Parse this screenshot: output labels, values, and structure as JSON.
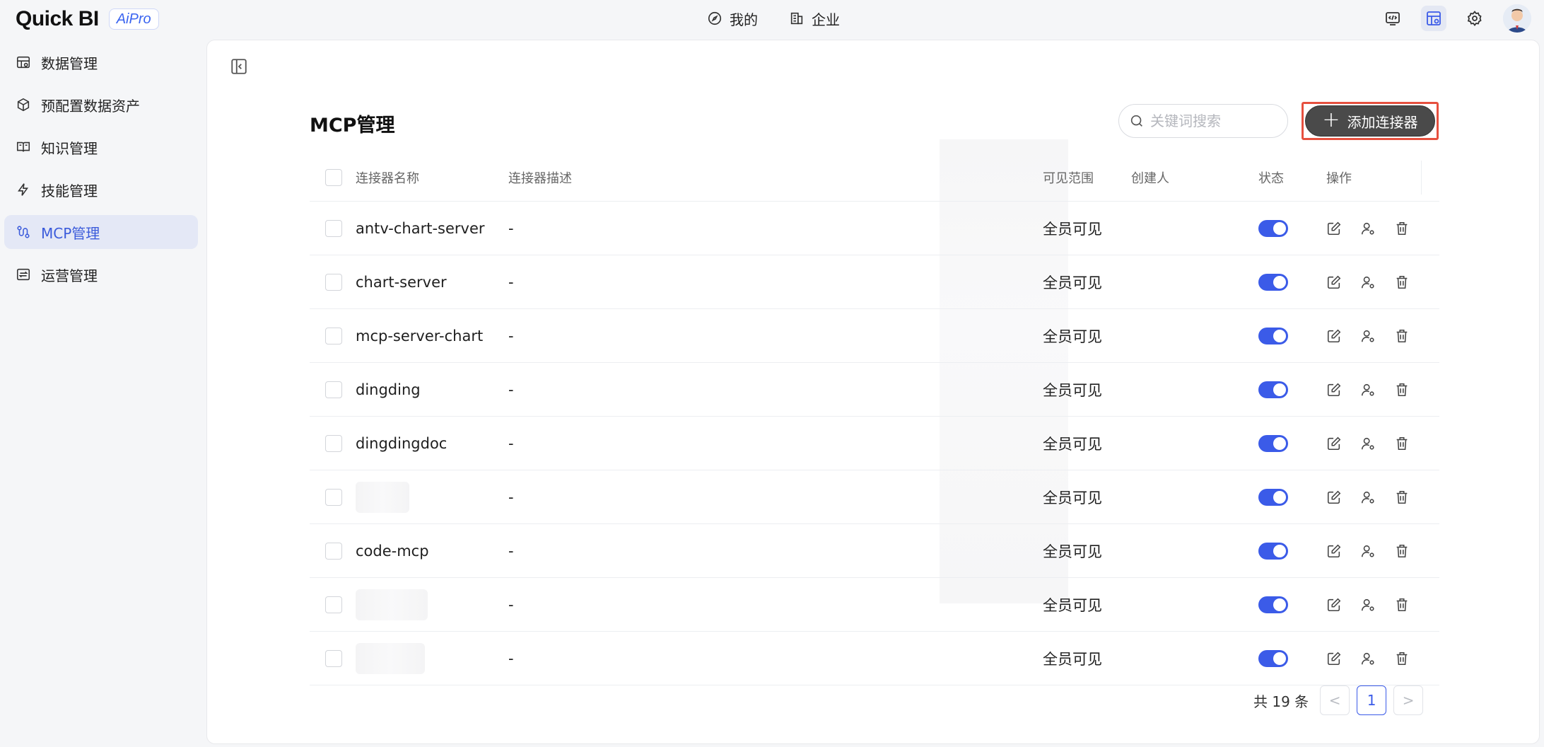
{
  "header": {
    "logo": "Quick BI",
    "badge": "AiPro",
    "nav": [
      {
        "label": "我的",
        "icon": "compass-icon"
      },
      {
        "label": "企业",
        "icon": "building-icon"
      }
    ],
    "tools": [
      "code-icon",
      "dashboard-icon",
      "gear-icon"
    ]
  },
  "sidebar": {
    "items": [
      {
        "label": "数据管理",
        "icon": "data-table-icon"
      },
      {
        "label": "预配置数据资产",
        "icon": "cube-icon"
      },
      {
        "label": "知识管理",
        "icon": "book-icon"
      },
      {
        "label": "技能管理",
        "icon": "lightning-icon"
      },
      {
        "label": "MCP管理",
        "icon": "mcp-icon",
        "active": true
      },
      {
        "label": "运营管理",
        "icon": "operations-icon"
      }
    ]
  },
  "main": {
    "title": "MCP管理",
    "search_placeholder": "关键词搜索",
    "add_button": "添加连接器",
    "columns": {
      "name": "连接器名称",
      "desc": "连接器描述",
      "scope": "可见范围",
      "creator": "创建人",
      "status": "状态",
      "ops": "操作"
    },
    "rows": [
      {
        "name": "antv-chart-server",
        "desc": "-",
        "scope": "全员可见",
        "enabled": true
      },
      {
        "name": "chart-server",
        "desc": "-",
        "scope": "全员可见",
        "enabled": true
      },
      {
        "name": "mcp-server-chart",
        "desc": "-",
        "scope": "全员可见",
        "enabled": true
      },
      {
        "name": "dingding",
        "desc": "-",
        "scope": "全员可见",
        "enabled": true
      },
      {
        "name": "dingdingdoc",
        "desc": "-",
        "scope": "全员可见",
        "enabled": true
      },
      {
        "name": "",
        "desc": "-",
        "scope": "全员可见",
        "enabled": true
      },
      {
        "name": "code-mcp",
        "desc": "-",
        "scope": "全员可见",
        "enabled": true
      },
      {
        "name": "",
        "desc": "-",
        "scope": "全员可见",
        "enabled": true
      },
      {
        "name": "",
        "desc": "-",
        "scope": "全员可见",
        "enabled": true
      }
    ],
    "pagination": {
      "total": "共 19 条",
      "current": "1",
      "prev": "<",
      "next": ">"
    }
  },
  "colors": {
    "accent": "#3b5be8",
    "highlight": "#e6503f",
    "button": "#4a4a4a"
  }
}
